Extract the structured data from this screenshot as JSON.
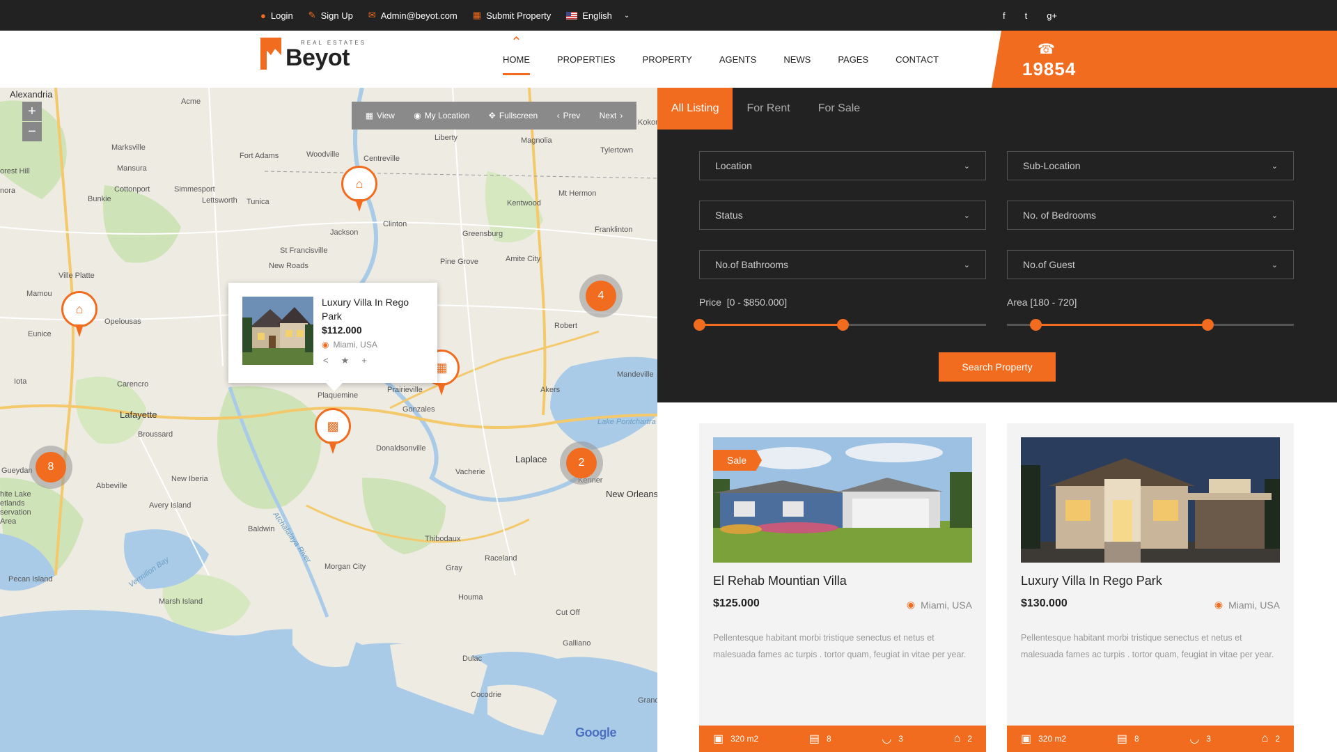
{
  "topbar": {
    "login": "Login",
    "signup": "Sign Up",
    "email": "Admin@beyot.com",
    "submit": "Submit Property",
    "language": "English",
    "social": [
      "f",
      "t",
      "g+"
    ]
  },
  "logo": {
    "small": "REAL ESTATES",
    "big": "Beyot"
  },
  "nav": [
    "HOME",
    "PROPERTIES",
    "PROPERTY",
    "AGENTS",
    "NEWS",
    "PAGES",
    "CONTACT"
  ],
  "phone": "19854",
  "map": {
    "toolbar": {
      "view": "View",
      "location": "My Location",
      "fullscreen": "Fullscreen",
      "prev": "Prev",
      "next": "Next"
    },
    "clusters": [
      "4",
      "8",
      "2"
    ],
    "popup": {
      "title": "Luxury Villa In Rego Park",
      "price": "$112.000",
      "location": "Miami, USA"
    },
    "labels": {
      "alexandria": "Alexandria",
      "acme": "Acme",
      "marksville": "Marksville",
      "mansura": "Mansura",
      "cottonport": "Cottonport",
      "bunkie": "Bunkie",
      "simmesport": "Simmesport",
      "lettsworth": "Lettsworth",
      "tunica": "Tunica",
      "fortadams": "Fort Adams",
      "woodville": "Woodville",
      "centreville": "Centreville",
      "liberty": "Liberty",
      "magnolia": "Magnolia",
      "tylertown": "Tylertown",
      "kokomo": "Kokor",
      "kentwood": "Kentwood",
      "mthermon": "Mt Hermon",
      "franklinton": "Franklinton",
      "jackson": "Jackson",
      "clinton": "Clinton",
      "greensburg": "Greensburg",
      "stfrancisville": "St Francisville",
      "newroads": "New Roads",
      "pinegrove": "Pine Grove",
      "amitecity": "Amite City",
      "villeplatte": "Ville Platte",
      "mamou": "Mamou",
      "opelousas": "Opelousas",
      "eunice": "Eunice",
      "iota": "Iota",
      "carencro": "Carencro",
      "lafayette": "Lafayette",
      "broussard": "Broussard",
      "plaquemine": "Plaquemine",
      "prairieville": "Prairieville",
      "gonzales": "Gonzales",
      "robert": "Robert",
      "mandeville": "Mandeville",
      "akers": "Akers",
      "lakepontchartrain": "Lake Pontchartra",
      "donaldsonville": "Donaldsonville",
      "vacherie": "Vacherie",
      "laplace": "Laplace",
      "kenner": "Kenner",
      "neworleans": "New Orleans",
      "gueydan": "Gueydan",
      "abbeville": "Abbeville",
      "newiberia": "New Iberia",
      "averyisland": "Avery Island",
      "whitelake": "hite Lake\netlands\nservation\nArea",
      "baldwin": "Baldwin",
      "atchafalaya": "Atchafalaya River",
      "vermilionbay": "Vermilion Bay",
      "morgancity": "Morgan City",
      "thibodaux": "Thibodaux",
      "raceland": "Raceland",
      "gray": "Gray",
      "pecanisland": "Pecan Island",
      "marshisland": "Marsh Island",
      "houma": "Houma",
      "cutoff": "Cut Off",
      "galliano": "Galliano",
      "dulac": "Dulac",
      "cocodrie": "Cocodrie",
      "grand": "Grand",
      "foresthill": "orest Hill",
      "nora": "nora",
      "google": "Google"
    }
  },
  "search": {
    "tabs": [
      "All Listing",
      "For Rent",
      "For Sale"
    ],
    "location": "Location",
    "sublocation": "Sub-Location",
    "status": "Status",
    "bedrooms": "No. of Bedrooms",
    "bathrooms": "No.of Bathrooms",
    "guest": "No.of Guest",
    "price_label": "Price",
    "price_range": "[0 - $850.000]",
    "price_fill": [
      0,
      0.5
    ],
    "area_label": "Area",
    "area_range": "[180 - 720]",
    "area_fill": [
      0.1,
      0.7
    ],
    "button": "Search Property"
  },
  "listings": [
    {
      "badge": "Sale",
      "title": "El Rehab Mountian Villa",
      "price": "$125.000",
      "location": "Miami, USA",
      "desc": "Pellentesque habitant morbi tristique senectus et netus et malesuada fames ac turpis . tortor quam, feugiat in vitae per year.",
      "area": "320 m2",
      "beds": "8",
      "baths": "3",
      "garage": "2"
    },
    {
      "title": "Luxury Villa In Rego Park",
      "price": "$130.000",
      "location": "Miami, USA",
      "desc": "Pellentesque habitant morbi tristique senectus et netus et malesuada fames ac turpis . tortor quam, feugiat in vitae per year.",
      "area": "320 m2",
      "beds": "8",
      "baths": "3",
      "garage": "2"
    }
  ],
  "colors": {
    "accent": "#f26c1f",
    "dark": "#222222"
  }
}
